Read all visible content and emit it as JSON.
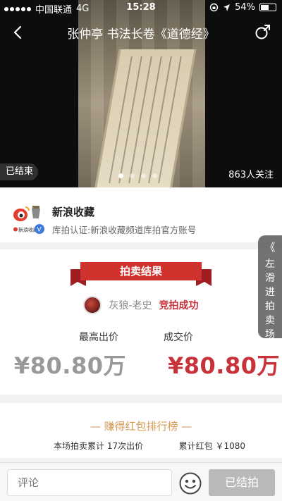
{
  "status_bar": {
    "carrier": "中国联通",
    "network": "4G",
    "time": "15:28",
    "battery": "54%",
    "battery_level": 0.54
  },
  "navbar": {
    "title": "张仲亭 书法长卷《道德经》"
  },
  "hero": {
    "ended_tag": "已结束",
    "followers": "863人关注",
    "page_count": 4,
    "active_page": 1
  },
  "seller": {
    "name": "新浪收藏",
    "certification": "库拍认证:新浪收藏频道库拍官方账号",
    "logo_caption": "新浪收藏"
  },
  "side_tab": {
    "label": "左滑进拍卖场"
  },
  "result": {
    "banner": "拍卖结果",
    "winner_name": "灰狼-老史",
    "winner_status": "竞拍成功",
    "highest_bid_label": "最高出价",
    "highest_bid_value": "¥80.80万",
    "deal_price_label": "成交价",
    "deal_price_value": "¥80.80万"
  },
  "rank": {
    "title": "— 赚得红包排行榜 —",
    "bid_count": "本场拍卖累计 17次出价",
    "red_packet_total": "累计红包 ￥1080"
  },
  "bottom_bar": {
    "comment_placeholder": "评论",
    "ended_button": "已结拍"
  },
  "colors": {
    "accent_red": "#c8323a",
    "rank_gold": "#d79a53",
    "disabled_gray": "#b9b9b9"
  }
}
